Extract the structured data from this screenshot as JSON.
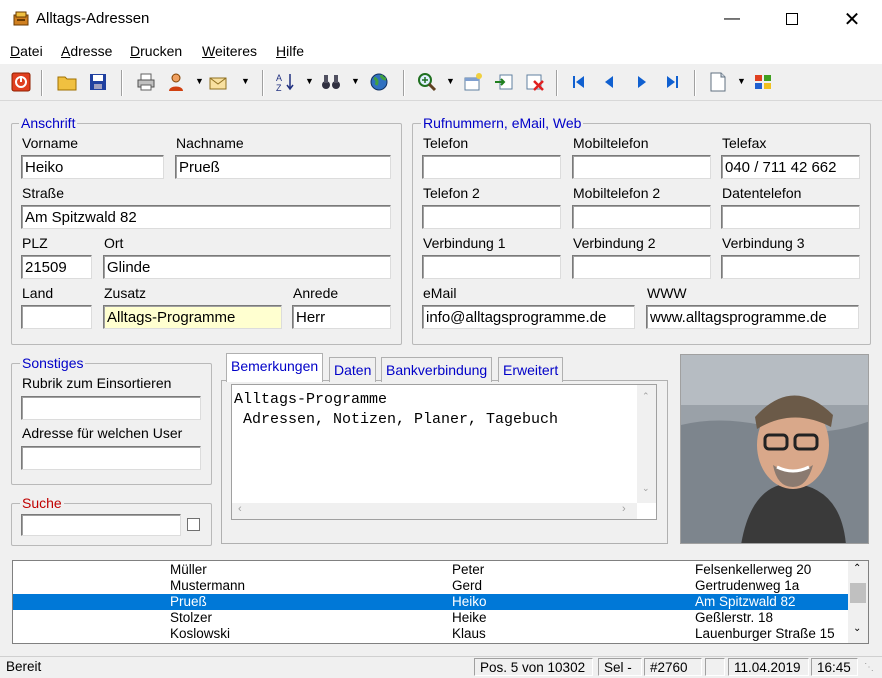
{
  "window": {
    "title": "Alltags-Adressen"
  },
  "menu": [
    {
      "accel": "D",
      "rest": "atei"
    },
    {
      "accel": "A",
      "rest": "dresse"
    },
    {
      "accel": "D",
      "rest": "rucken"
    },
    {
      "accel": "W",
      "rest": "eiteres"
    },
    {
      "accel": "H",
      "rest": "ilfe"
    }
  ],
  "toolbar": {
    "icons": [
      "power-icon",
      "open-folder-icon",
      "save-icon",
      "print-icon",
      "person-icon",
      "mail-icon",
      "sort-icon",
      "search-binoculars-icon",
      "globe-icon",
      "zoom-icon",
      "new-record-icon",
      "import-icon",
      "delete-record-icon",
      "first-record-icon",
      "previous-record-icon",
      "next-record-icon",
      "last-record-icon",
      "document-icon",
      "windows-icon"
    ]
  },
  "anschrift": {
    "legend": "Anschrift",
    "vorname_label": "Vorname",
    "vorname": "Heiko",
    "nachname_label": "Nachname",
    "nachname": "Prueß",
    "strasse_label": "Straße",
    "strasse": "Am Spitzwald 82",
    "plz_label": "PLZ",
    "plz": "21509",
    "ort_label": "Ort",
    "ort": "Glinde",
    "land_label": "Land",
    "land": "",
    "zusatz_label": "Zusatz",
    "zusatz": "Alltags-Programme",
    "anrede_label": "Anrede",
    "anrede": "Herr"
  },
  "rufnummern": {
    "legend": "Rufnummern, eMail, Web",
    "telefon_label": "Telefon",
    "telefon": "",
    "mobil_label": "Mobiltelefon",
    "mobil": "",
    "telefax_label": "Telefax",
    "telefax": "040 / 711 42 662",
    "telefon2_label": "Telefon 2",
    "telefon2": "",
    "mobil2_label": "Mobiltelefon 2",
    "mobil2": "",
    "daten_label": "Datentelefon",
    "daten": "",
    "verb1_label": "Verbindung 1",
    "verb1": "",
    "verb2_label": "Verbindung 2",
    "verb2": "",
    "verb3_label": "Verbindung 3",
    "verb3": "",
    "email_label": "eMail",
    "email": "info@alltagsprogramme.de",
    "www_label": "WWW",
    "www": "www.alltagsprogramme.de"
  },
  "sonstiges": {
    "legend": "Sonstiges",
    "rubrik_label": "Rubrik zum Einsortieren",
    "rubrik": "",
    "user_label": "Adresse für welchen User",
    "user": ""
  },
  "suche": {
    "legend": "Suche",
    "value": ""
  },
  "tabs": [
    "Bemerkungen",
    "Daten",
    "Bankverbindung",
    "Erweitert"
  ],
  "memo": "Alltags-Programme\n Adressen, Notizen, Planer, Tagebuch",
  "list": [
    {
      "name": "Müller",
      "vorname": "Peter",
      "strasse": "Felsenkellerweg 20"
    },
    {
      "name": "Mustermann",
      "vorname": "Gerd",
      "strasse": "Gertrudenweg 1a"
    },
    {
      "name": "Prueß",
      "vorname": "Heiko",
      "strasse": "Am Spitzwald 82"
    },
    {
      "name": "Stolzer",
      "vorname": "Heike",
      "strasse": "Geßlerstr. 18"
    },
    {
      "name": "Koslowski",
      "vorname": "Klaus",
      "strasse": "Lauenburger Straße 15"
    }
  ],
  "selected_row": 2,
  "status": {
    "text": "Bereit",
    "position": "Pos. 5 von 10302",
    "sel": "Sel -",
    "id": "#2760",
    "empty": "",
    "date": "11.04.2019",
    "time": "16:45"
  },
  "colors": {
    "accent": "#0078d7",
    "legend_blue": "#0000c8",
    "legend_red": "#c00000",
    "highlight_field": "#ffffd0"
  }
}
